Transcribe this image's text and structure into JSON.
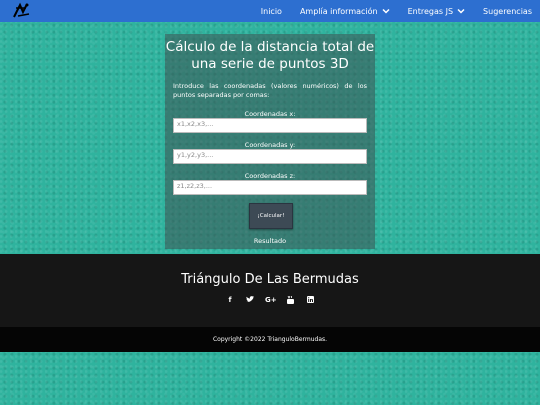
{
  "nav": {
    "links": [
      {
        "label": "Inicio",
        "dropdown": false
      },
      {
        "label": "Amplía información",
        "dropdown": true
      },
      {
        "label": "Entregas JS",
        "dropdown": true
      },
      {
        "label": "Sugerencias",
        "dropdown": false
      }
    ]
  },
  "form": {
    "title": "Cálculo de la distancia total de una serie de puntos 3D",
    "intro": "Introduce las coordenadas (valores numéricos) de los puntos separadas por comas:",
    "x_label": "Coordenadas x:",
    "x_placeholder": "x1,x2,x3,...",
    "y_label": "Coordenadas y:",
    "y_placeholder": "y1,y2,y3,...",
    "z_label": "Coordenadas z:",
    "z_placeholder": "z1,z2,z3,...",
    "button_label": "¡Calcular!",
    "result_label": "Resultado"
  },
  "footer": {
    "title": "Triángulo De Las Bermudas",
    "social_icons": [
      "facebook-icon",
      "twitter-icon",
      "google-plus-icon",
      "youtube-icon",
      "linkedin-icon"
    ],
    "copyright": "Copyright ©2022 TrianguloBermudas."
  },
  "colors": {
    "navbar": "#2d6fd0",
    "background": "#2fb39e",
    "footer": "#161616",
    "copyright_bar": "#050505",
    "button": "#3d4a55"
  }
}
